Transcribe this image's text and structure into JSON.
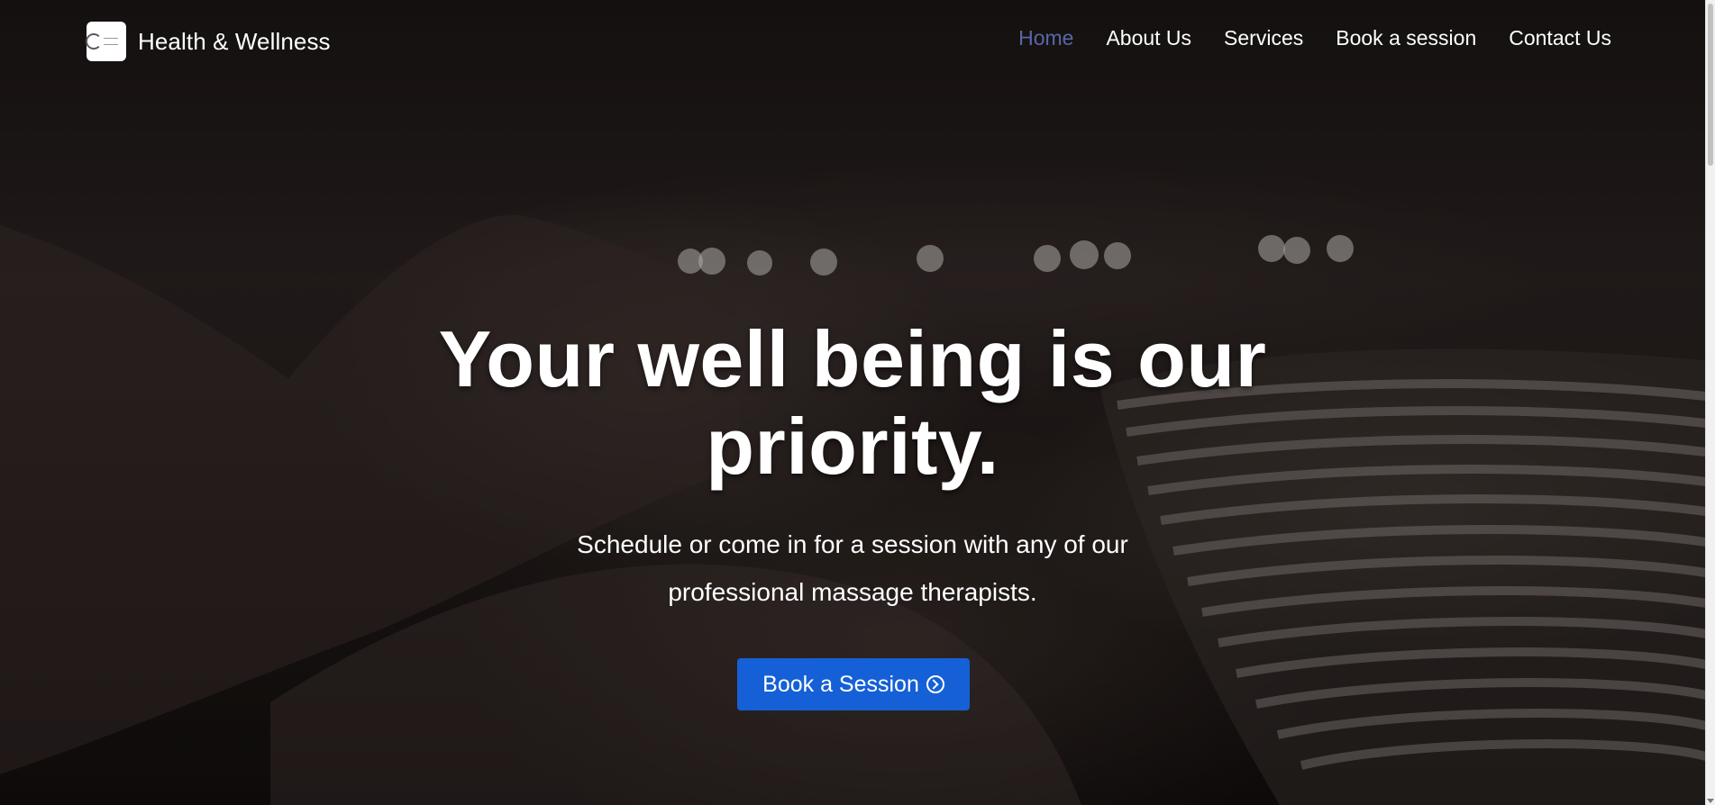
{
  "brand": {
    "name": "Health & Wellness",
    "logo_icon": "brand-logo-icon"
  },
  "nav": {
    "items": [
      {
        "label": "Home",
        "active": true
      },
      {
        "label": "About Us",
        "active": false
      },
      {
        "label": "Services",
        "active": false
      },
      {
        "label": "Book a session",
        "active": false
      },
      {
        "label": "Contact Us",
        "active": false
      }
    ],
    "active_color": "#5a66a8"
  },
  "hero": {
    "title_line1": "Your well being is our",
    "title_line2": "priority.",
    "subtitle_line1": "Schedule or come in for a session with any of our",
    "subtitle_line2": "professional massage therapists.",
    "cta_label": "Book a Session",
    "cta_icon": "chevron-right-circle-icon",
    "cta_color": "#1560d6"
  }
}
